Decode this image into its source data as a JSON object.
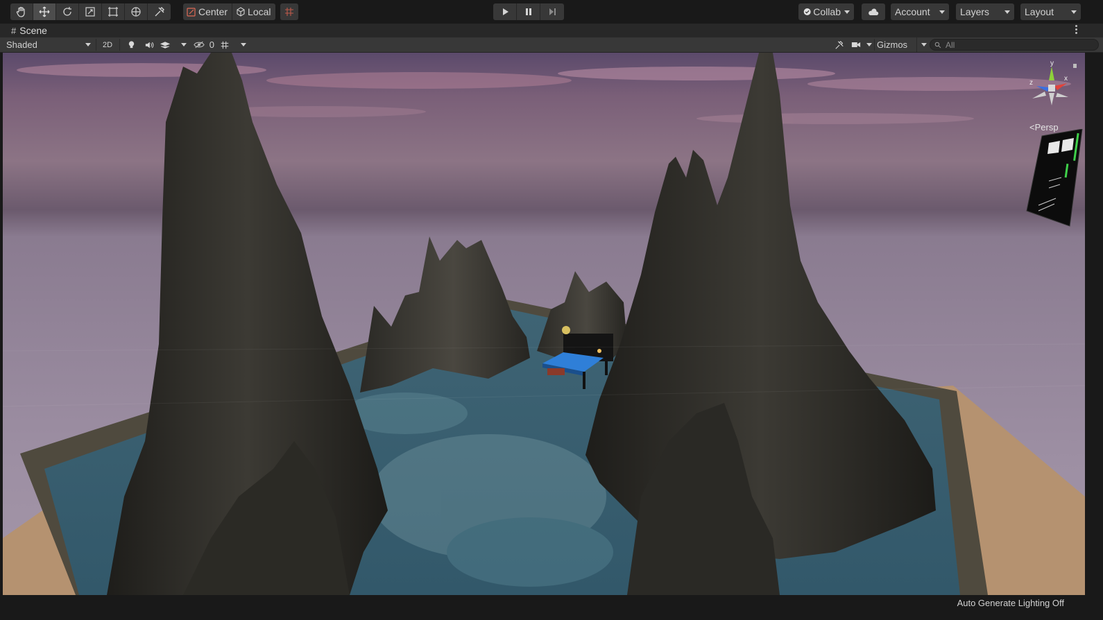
{
  "toolbar": {
    "tools": [
      {
        "name": "hand-tool",
        "icon": "hand-icon"
      },
      {
        "name": "move-tool",
        "icon": "move-arrows-icon",
        "active": true
      },
      {
        "name": "rotate-tool",
        "icon": "rotate-icon"
      },
      {
        "name": "scale-tool",
        "icon": "scale-icon"
      },
      {
        "name": "rect-tool",
        "icon": "rect-transform-icon"
      },
      {
        "name": "transform-tool",
        "icon": "transform-icon"
      },
      {
        "name": "custom-tool",
        "icon": "tools-icon"
      }
    ],
    "pivot_label": "Center",
    "space_label": "Local",
    "collab_label": "Collab",
    "account_label": "Account",
    "layers_label": "Layers",
    "layout_label": "Layout"
  },
  "scene_tab": {
    "label": "Scene"
  },
  "scene_toolbar": {
    "draw_mode": "Shaded",
    "mode_2d": "2D",
    "hidden_count": "0",
    "gizmos_label": "Gizmos",
    "search_placeholder": "All"
  },
  "viewport": {
    "projection_label": "Persp",
    "axes": {
      "y": "y",
      "x": "x",
      "z": "z"
    }
  },
  "status_bar": {
    "text": "Auto Generate Lighting Off"
  },
  "colors": {
    "accent_active": "#4d4d4d",
    "axis_x": "#e0433b",
    "axis_y": "#8ed13a",
    "axis_z": "#3a6fe0",
    "play_icon": "#c8c8c8"
  }
}
